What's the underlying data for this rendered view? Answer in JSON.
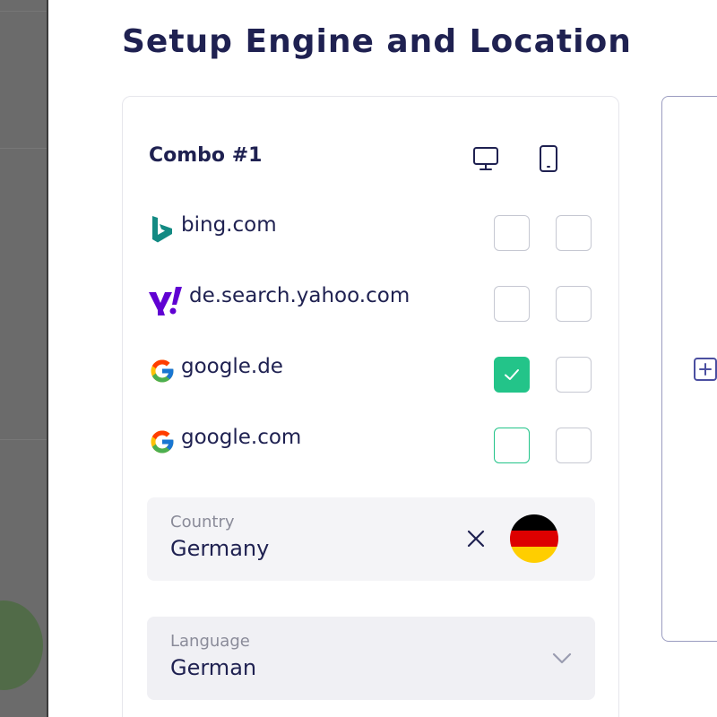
{
  "page": {
    "title": "Setup Engine and Location"
  },
  "combo": {
    "title": "Combo #1",
    "devices": [
      {
        "icon": "desktop-icon"
      },
      {
        "icon": "mobile-icon"
      }
    ],
    "engines": [
      {
        "label": "bing.com",
        "icon": "bing-logo-icon",
        "desktop_checked": false,
        "mobile_checked": false
      },
      {
        "label": "de.search.yahoo.com",
        "icon": "yahoo-logo-icon",
        "desktop_checked": false,
        "mobile_checked": false
      },
      {
        "label": "google.de",
        "icon": "google-logo-icon",
        "desktop_checked": true,
        "mobile_checked": false
      },
      {
        "label": "google.com",
        "icon": "google-logo-icon",
        "desktop_checked": false,
        "mobile_checked": false
      }
    ],
    "country": {
      "label": "Country",
      "value": "Germany",
      "clear_icon": "close-icon",
      "flag_icon": "germany-flag-icon"
    },
    "language": {
      "label": "Language",
      "value": "German",
      "dropdown_icon": "chevron-down-icon"
    }
  },
  "add_combo": {
    "icon": "plus-square-icon"
  },
  "colors": {
    "title": "#1f2151",
    "check_green": "#23c489",
    "bing": "#138a83",
    "yahoo": "#6001d2",
    "flag_black": "#000000",
    "flag_red": "#dd0000",
    "flag_gold": "#ffce00",
    "add_border": "#9a9cc0"
  }
}
